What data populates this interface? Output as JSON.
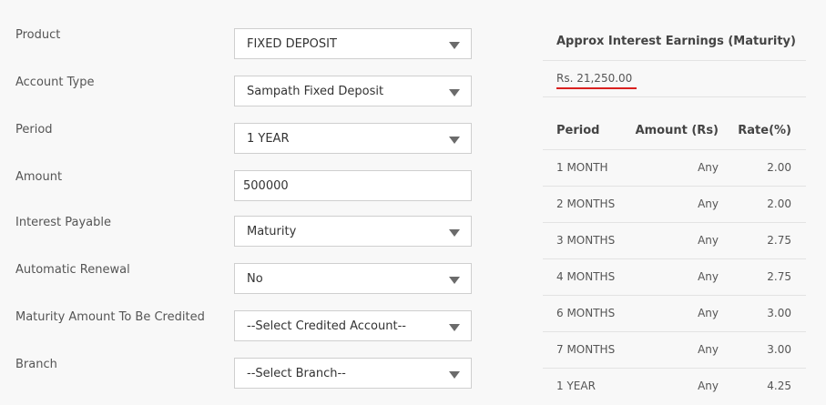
{
  "form": {
    "product": {
      "label": "Product",
      "value": "FIXED DEPOSIT"
    },
    "account_type": {
      "label": "Account Type",
      "value": "Sampath Fixed Deposit"
    },
    "period": {
      "label": "Period",
      "value": "1 YEAR"
    },
    "amount": {
      "label": "Amount",
      "value": "500000"
    },
    "interest_payable": {
      "label": "Interest Payable",
      "value": "Maturity"
    },
    "automatic_renewal": {
      "label": "Automatic Renewal",
      "value": "No"
    },
    "maturity_credit": {
      "label": "Maturity Amount To Be Credited",
      "value": "--Select Credited Account--"
    },
    "branch": {
      "label": "Branch",
      "value": "--Select Branch--"
    }
  },
  "side": {
    "title": "Approx Interest Earnings (Maturity)",
    "earnings": "Rs. 21,250.00",
    "accent_color": "#d9201f",
    "table": {
      "headers": [
        "Period",
        "Amount (Rs)",
        "Rate(%)"
      ],
      "rows": [
        [
          "1 MONTH",
          "Any",
          "2.00"
        ],
        [
          "2 MONTHS",
          "Any",
          "2.00"
        ],
        [
          "3 MONTHS",
          "Any",
          "2.75"
        ],
        [
          "4 MONTHS",
          "Any",
          "2.75"
        ],
        [
          "6 MONTHS",
          "Any",
          "3.00"
        ],
        [
          "7 MONTHS",
          "Any",
          "3.00"
        ],
        [
          "1 YEAR",
          "Any",
          "4.25"
        ]
      ]
    }
  }
}
